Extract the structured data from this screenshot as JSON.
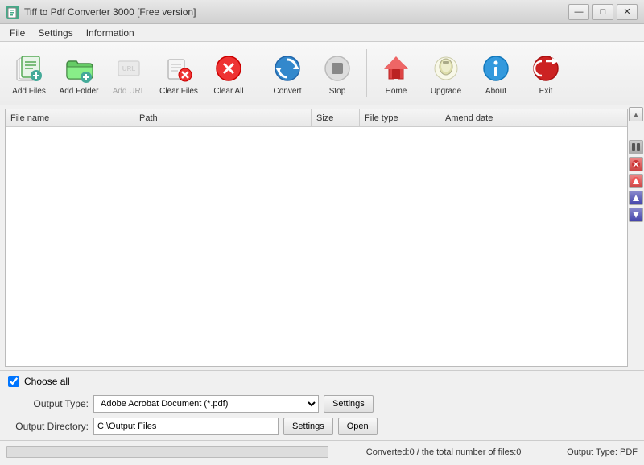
{
  "window": {
    "title": "Tiff to Pdf Converter 3000 [Free version]",
    "controls": {
      "minimize": "—",
      "maximize": "□",
      "close": "✕"
    }
  },
  "menu": {
    "items": [
      "File",
      "Settings",
      "Information"
    ]
  },
  "toolbar": {
    "buttons": [
      {
        "id": "add-files",
        "label": "Add Files",
        "disabled": false
      },
      {
        "id": "add-folder",
        "label": "Add Folder",
        "disabled": false
      },
      {
        "id": "add-url",
        "label": "Add URL",
        "disabled": true
      },
      {
        "id": "clear-files",
        "label": "Clear Files",
        "disabled": false
      },
      {
        "id": "clear-all",
        "label": "Clear All",
        "disabled": false
      },
      {
        "id": "convert",
        "label": "Convert",
        "disabled": false
      },
      {
        "id": "stop",
        "label": "Stop",
        "disabled": false
      },
      {
        "id": "home",
        "label": "Home",
        "disabled": false
      },
      {
        "id": "upgrade",
        "label": "Upgrade",
        "disabled": false
      },
      {
        "id": "about",
        "label": "About",
        "disabled": false
      },
      {
        "id": "exit",
        "label": "Exit",
        "disabled": false
      }
    ]
  },
  "file_list": {
    "columns": [
      "File name",
      "Path",
      "Size",
      "File type",
      "Amend date"
    ],
    "rows": []
  },
  "choose_all": {
    "label": "Choose all",
    "checked": true
  },
  "output": {
    "type_label": "Output Type:",
    "type_value": "Adobe Acrobat Document (*.pdf)",
    "type_settings_btn": "Settings",
    "dir_label": "Output Directory:",
    "dir_value": "C:\\Output Files",
    "dir_settings_btn": "Settings",
    "dir_open_btn": "Open"
  },
  "status": {
    "progress_text": "Converted:0  /  the total number of files:0",
    "output_type": "Output Type: PDF"
  },
  "right_panel": {
    "buttons": [
      "▲",
      "●",
      "●",
      "▲",
      "▼"
    ]
  }
}
